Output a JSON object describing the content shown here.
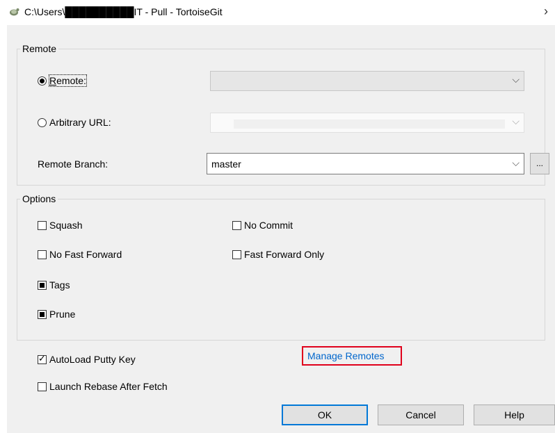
{
  "window": {
    "title": "C:\\Users\\██████████IT - Pull - TortoiseGit",
    "close_glyph": "×",
    "icon": "tortoisegit-icon"
  },
  "remote_group": {
    "legend": "Remote",
    "remote_radio_label": "Remote:",
    "remote_selected": true,
    "remote_combo_value": "",
    "arbitrary_url_label": "Arbitrary URL:",
    "arbitrary_url_value": "",
    "remote_branch_label": "Remote Branch:",
    "remote_branch_value": "master",
    "browse_label": "..."
  },
  "options_group": {
    "legend": "Options",
    "squash": {
      "label": "Squash",
      "state": "unchecked"
    },
    "no_commit": {
      "label": "No Commit",
      "state": "unchecked"
    },
    "no_fast_forward": {
      "label": "No Fast Forward",
      "state": "unchecked"
    },
    "fast_forward_only": {
      "label": "Fast Forward Only",
      "state": "unchecked"
    },
    "tags": {
      "label": "Tags",
      "state": "indeterminate"
    },
    "prune": {
      "label": "Prune",
      "state": "indeterminate"
    }
  },
  "autoload_putty_key": {
    "label": "AutoLoad Putty Key",
    "checked": true
  },
  "launch_rebase": {
    "label": "Launch Rebase After Fetch",
    "checked": false
  },
  "manage_remotes_link": "Manage Remotes",
  "buttons": {
    "ok": "OK",
    "cancel": "Cancel",
    "help": "Help"
  },
  "colors": {
    "link": "#0066cc",
    "highlight_box": "#e0001b",
    "default_button_border": "#0078d7"
  }
}
